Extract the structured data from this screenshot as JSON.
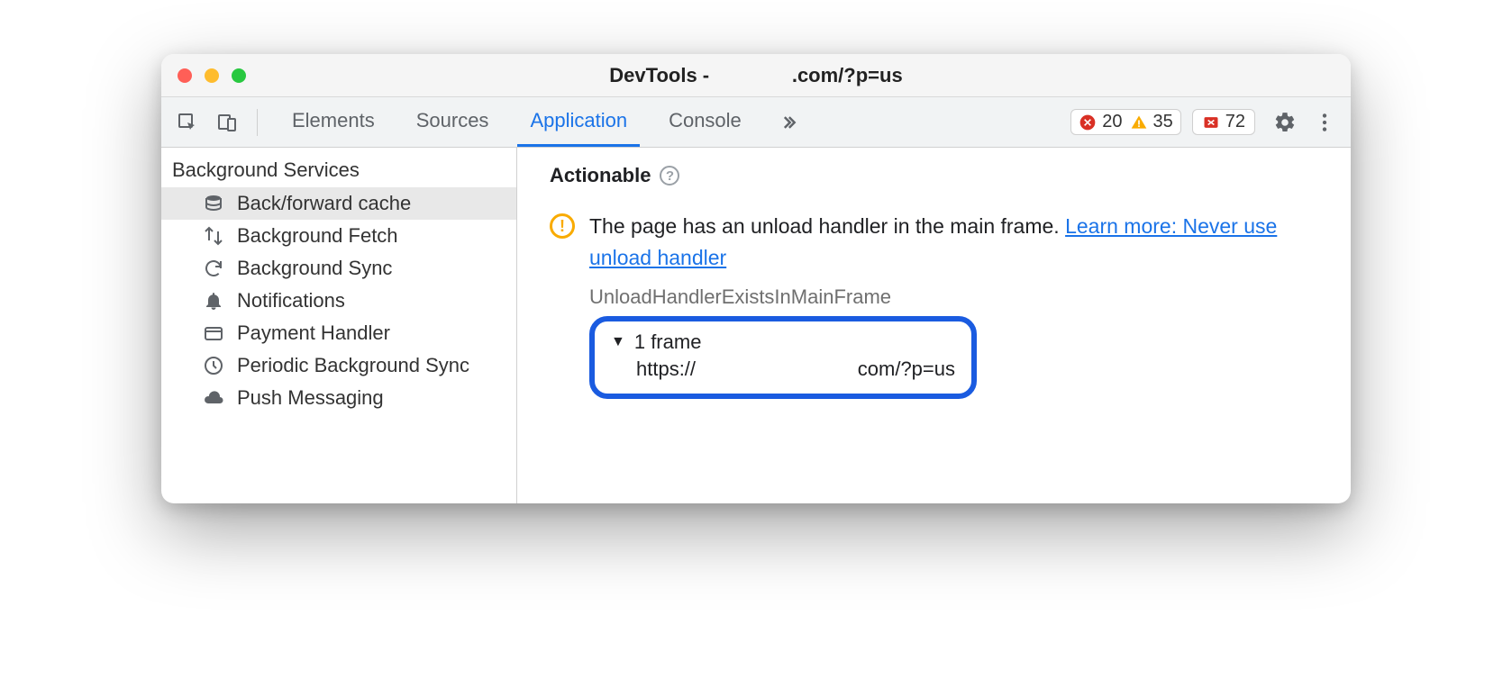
{
  "window": {
    "title_prefix": "DevTools - ",
    "title_suffix": ".com/?p=us"
  },
  "toolbar": {
    "tabs": [
      "Elements",
      "Sources",
      "Application",
      "Console"
    ],
    "active_tab_index": 2,
    "errors_count": "20",
    "warnings_count": "35",
    "issues_count": "72"
  },
  "sidebar": {
    "heading": "Background Services",
    "items": [
      {
        "label": "Back/forward cache",
        "icon": "database",
        "selected": true
      },
      {
        "label": "Background Fetch",
        "icon": "swap",
        "selected": false
      },
      {
        "label": "Background Sync",
        "icon": "sync",
        "selected": false
      },
      {
        "label": "Notifications",
        "icon": "bell",
        "selected": false
      },
      {
        "label": "Payment Handler",
        "icon": "card",
        "selected": false
      },
      {
        "label": "Periodic Background Sync",
        "icon": "clock",
        "selected": false
      },
      {
        "label": "Push Messaging",
        "icon": "cloud",
        "selected": false
      }
    ]
  },
  "content": {
    "section_title": "Actionable",
    "warning_text": "The page has an unload handler in the main frame. ",
    "learn_more_text": "Learn more: Never use unload handler",
    "reason_code": "UnloadHandlerExistsInMainFrame",
    "frame_summary": "1 frame",
    "frame_url_left": "https://",
    "frame_url_right": "com/?p=us"
  }
}
